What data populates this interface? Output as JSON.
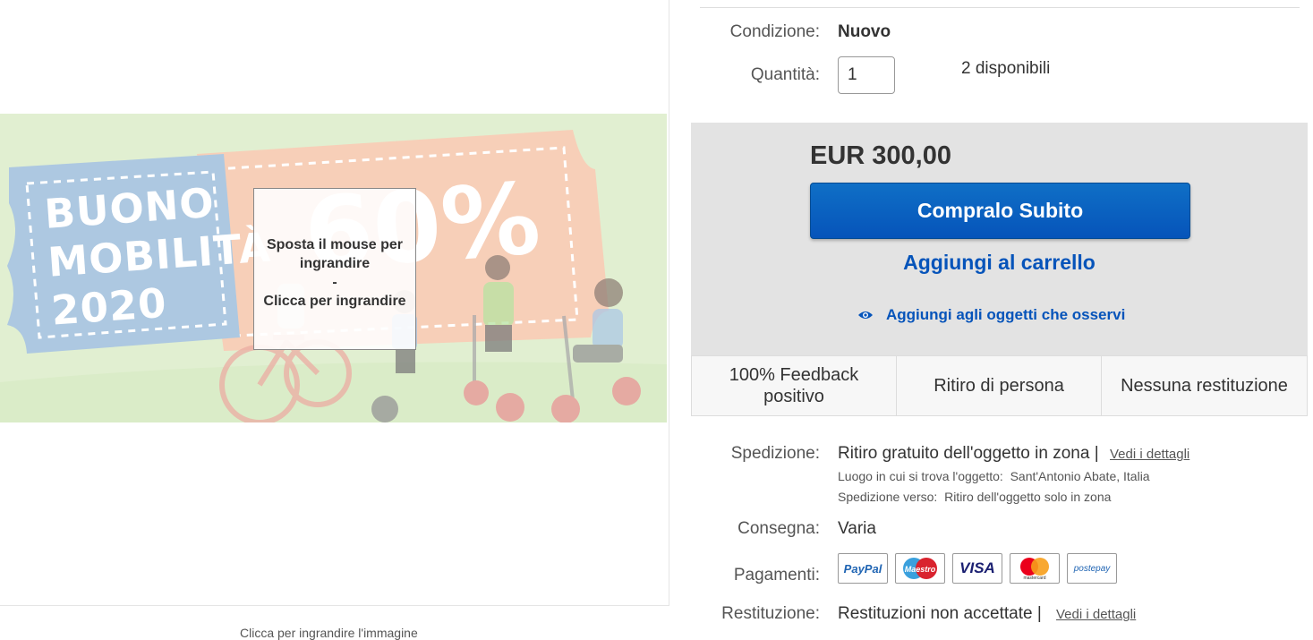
{
  "image_panel": {
    "hero_lines": [
      "BUONO",
      "MOBILITÀ",
      "2020"
    ],
    "hero_percent": "60%",
    "zoom_hint_line1": "Sposta il mouse per ingrandire",
    "zoom_hint_sep": "-",
    "zoom_hint_line2": "Clicca per ingrandire",
    "caption": "Clicca per ingrandire l'immagine"
  },
  "details": {
    "condition_label": "Condizione:",
    "condition_value": "Nuovo",
    "quantity_label": "Quantità:",
    "quantity_value": "1",
    "available": "2 disponibili"
  },
  "buy_box": {
    "price": "EUR 300,00",
    "buy_now": "Compralo Subito",
    "add_to_cart": "Aggiungi al carrello",
    "watch": "Aggiungi agli oggetti che osservi"
  },
  "features": [
    "100% Feedback positivo",
    "Ritiro di persona",
    "Nessuna restituzione"
  ],
  "shipping": {
    "label": "Spedizione:",
    "value": "Ritiro gratuito dell'oggetto in zona |",
    "link": "Vedi i dettagli",
    "location_label": "Luogo in cui si trova l'oggetto:",
    "location_value": "Sant'Antonio Abate, Italia",
    "ships_to_label": "Spedizione verso:",
    "ships_to_value": "Ritiro dell'oggetto solo in zona"
  },
  "delivery": {
    "label": "Consegna:",
    "value": "Varia"
  },
  "payments": {
    "label": "Pagamenti:",
    "methods": [
      "PayPal",
      "Maestro",
      "VISA",
      "mastercard",
      "postepay"
    ]
  },
  "returns": {
    "label": "Restituzione:",
    "value": "Restituzioni non accettate |",
    "link": "Vedi i dettagli"
  },
  "colors": {
    "link_blue": "#0654ba",
    "buy_blue": "#0f6fc6",
    "box_grey": "#e3e3e3"
  }
}
